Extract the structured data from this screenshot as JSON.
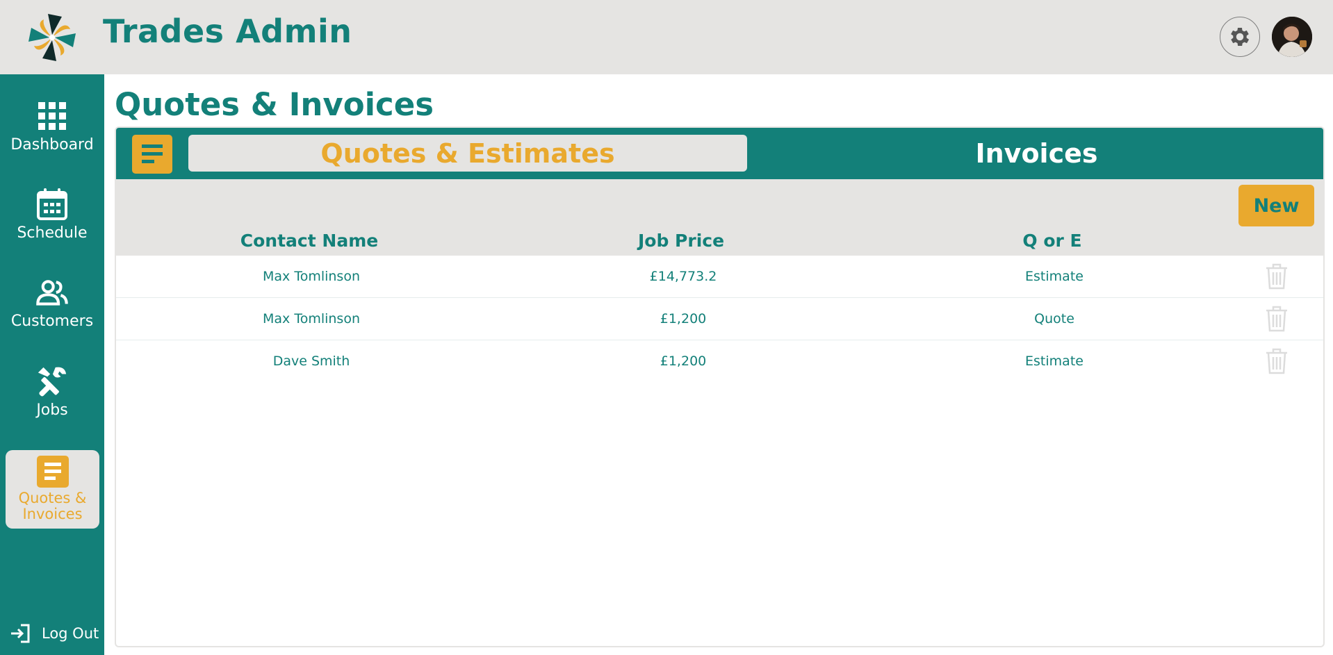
{
  "app": {
    "title": "Trades Admin"
  },
  "sidebar": {
    "items": [
      {
        "label": "Dashboard",
        "icon": "grid-icon"
      },
      {
        "label": "Schedule",
        "icon": "calendar-icon"
      },
      {
        "label": "Customers",
        "icon": "users-icon"
      },
      {
        "label": "Jobs",
        "icon": "tools-icon"
      },
      {
        "label": "Quotes & Invoices",
        "icon": "document-icon",
        "active": true
      }
    ],
    "logout_label": "Log Out"
  },
  "page": {
    "title": "Quotes & Invoices"
  },
  "tabs": [
    {
      "label": "Quotes & Estimates",
      "active": true
    },
    {
      "label": "Invoices",
      "active": false
    }
  ],
  "table": {
    "new_label": "New",
    "columns": [
      "Contact Name",
      "Job Price",
      "Q or E"
    ],
    "rows": [
      {
        "contact": "Max Tomlinson",
        "price": "£14,773.2",
        "type": "Estimate"
      },
      {
        "contact": "Max Tomlinson",
        "price": "£1,200",
        "type": "Quote"
      },
      {
        "contact": "Dave Smith",
        "price": "£1,200",
        "type": "Estimate"
      }
    ]
  },
  "colors": {
    "teal": "#138079",
    "gold": "#e9a92e",
    "light_gray": "#e5e4e2"
  }
}
